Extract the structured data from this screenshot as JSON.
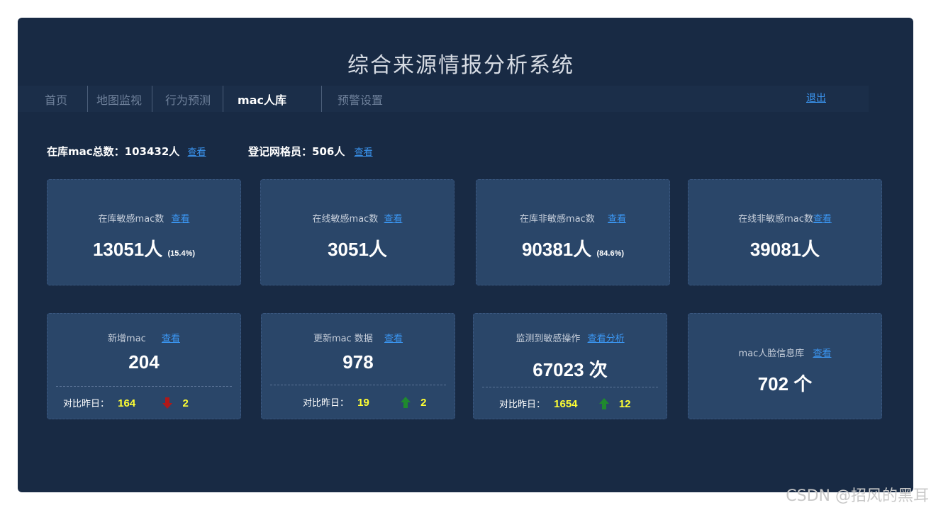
{
  "app": {
    "title": "综合来源情报分析系统"
  },
  "nav": {
    "items": [
      {
        "label": "首页"
      },
      {
        "label": "地图监视"
      },
      {
        "label": "行为预测"
      },
      {
        "label": "mac人库"
      },
      {
        "label": "预警设置"
      }
    ],
    "active_index": 3,
    "logout_label": "退出"
  },
  "summary": {
    "mac_total_label": "在库mac总数：",
    "mac_total_value": "103432人",
    "mac_total_link": "查看",
    "grid_label": "登记网格员：",
    "grid_value": "506人",
    "grid_link": "查看"
  },
  "cards_row1": [
    {
      "label": "在库敏感mac数",
      "link": "查看",
      "value": "13051人",
      "pct": "(15.4%)"
    },
    {
      "label": "在线敏感mac数",
      "link": "查看",
      "value": "3051人",
      "pct": ""
    },
    {
      "label": "在库非敏感mac数",
      "link": "查看",
      "value": "90381人",
      "pct": "(84.6%)"
    },
    {
      "label": "在线非敏感mac数",
      "link": "查看",
      "value": "39081人",
      "pct": ""
    }
  ],
  "cards_row2": [
    {
      "label": "新增mac",
      "link": "查看",
      "value": "204",
      "compare_label": "对比昨日：",
      "compare_value": "164",
      "trend": "down",
      "trend_value": "2"
    },
    {
      "label": "更新mac 数据",
      "link": "查看",
      "value": "978",
      "compare_label": "对比昨日：",
      "compare_value": "19",
      "trend": "up",
      "trend_value": "2"
    },
    {
      "label": "监测到敏感操作",
      "link": "查看分析",
      "value": "67023 次",
      "compare_label": "对比昨日：",
      "compare_value": "1654",
      "trend": "up",
      "trend_value": "12"
    },
    {
      "label": "mac人脸信息库",
      "link": "查看",
      "value": "702 个"
    }
  ],
  "colors": {
    "panel_bg": "#182a44",
    "card_bg": "#2a4669",
    "link": "#3b96f2",
    "highlight": "#ffff33",
    "trend_up": "#1f8a2e",
    "trend_down": "#b01818"
  },
  "watermark": "CSDN @招风的黑耳"
}
